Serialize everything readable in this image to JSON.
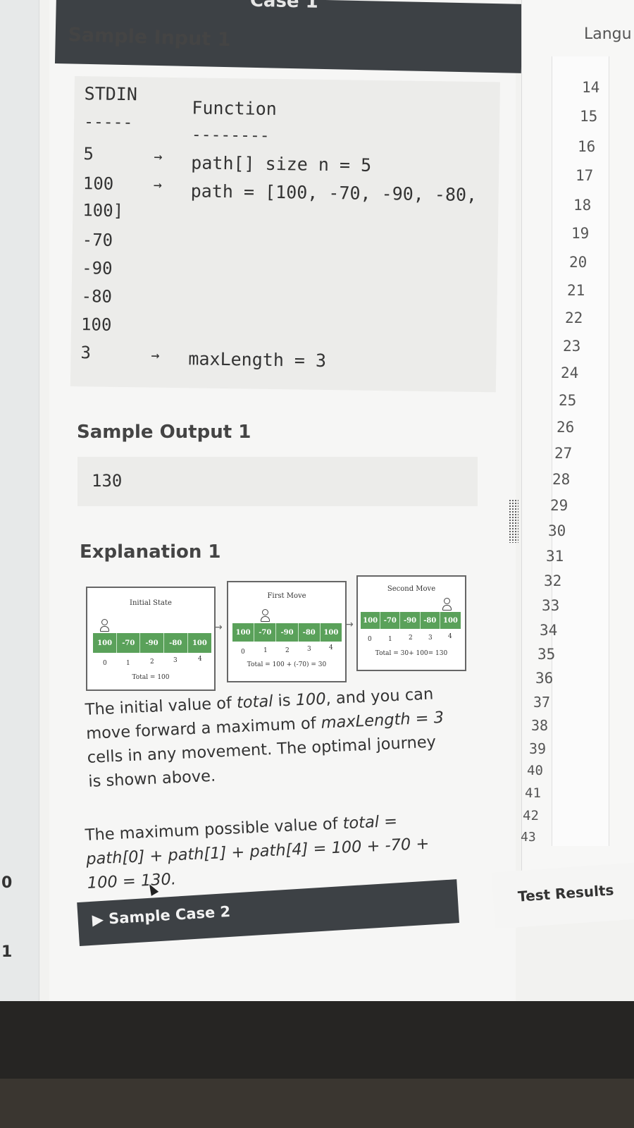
{
  "left_strip": {
    "numbers": [
      "0",
      "1"
    ]
  },
  "header": {
    "cut_title": "Case 1"
  },
  "sample_input": {
    "heading": "Sample Input 1",
    "col_stdin": "STDIN",
    "col_function": "Function",
    "dash_stdin": "-----",
    "dash_function": "--------",
    "rows": [
      {
        "stdin": "5",
        "arrow": "→",
        "function": "path[] size n = 5"
      },
      {
        "stdin": "100",
        "arrow": "→",
        "function": "path = [100, -70, -90, -80,"
      },
      {
        "stdin": "100]",
        "arrow": "",
        "function": ""
      },
      {
        "stdin": "-70",
        "arrow": "",
        "function": ""
      },
      {
        "stdin": "-90",
        "arrow": "",
        "function": ""
      },
      {
        "stdin": "-80",
        "arrow": "",
        "function": ""
      },
      {
        "stdin": "100",
        "arrow": "",
        "function": ""
      },
      {
        "stdin": "3",
        "arrow": "→",
        "function": "maxLength = 3"
      }
    ]
  },
  "sample_output": {
    "heading": "Sample Output 1",
    "value": "130"
  },
  "explanation": {
    "heading": "Explanation 1",
    "diagram": {
      "panels": [
        {
          "title": "Initial State",
          "cells": [
            "100",
            "-70",
            "-90",
            "-80",
            "100"
          ],
          "indices": [
            "0",
            "1",
            "2",
            "3",
            "4"
          ],
          "total": "Total = 100"
        },
        {
          "title": "First Move",
          "cells": [
            "100",
            "-70",
            "-90",
            "-80",
            "100"
          ],
          "indices": [
            "0",
            "1",
            "2",
            "3",
            "4"
          ],
          "total": "Total = 100 + (-70) = 30"
        },
        {
          "title": "Second Move",
          "cells": [
            "100",
            "-70",
            "-90",
            "-80",
            "100"
          ],
          "indices": [
            "0",
            "1",
            "2",
            "3",
            "4"
          ],
          "total": "Total = 30+ 100= 130"
        }
      ]
    },
    "para1": {
      "t1": "The initial value of ",
      "i1": "total",
      "t2": " is ",
      "i2": "100",
      "t3": ", and you can move forward a maximum of ",
      "i3": "maxLength = 3",
      "t4": " cells in any movement. The optimal journey is shown above."
    },
    "para2": {
      "t1": "The maximum possible value of ",
      "i1": "total = path[0] + path[1] + path[4] = 100 + -70 + 100 = 130."
    }
  },
  "sample_case_2": {
    "arrow": "▶",
    "label": "Sample Case 2"
  },
  "editor": {
    "language_label": "Langu",
    "line_numbers": [
      "14",
      "15",
      "16",
      "17",
      "18",
      "19",
      "20",
      "21",
      "22",
      "23",
      "24",
      "25",
      "26",
      "27",
      "28",
      "29",
      "30",
      "31",
      "32",
      "33",
      "34",
      "35",
      "36",
      "37",
      "38",
      "39",
      "40",
      "41",
      "42",
      "43"
    ]
  },
  "test_results": "Test Results"
}
